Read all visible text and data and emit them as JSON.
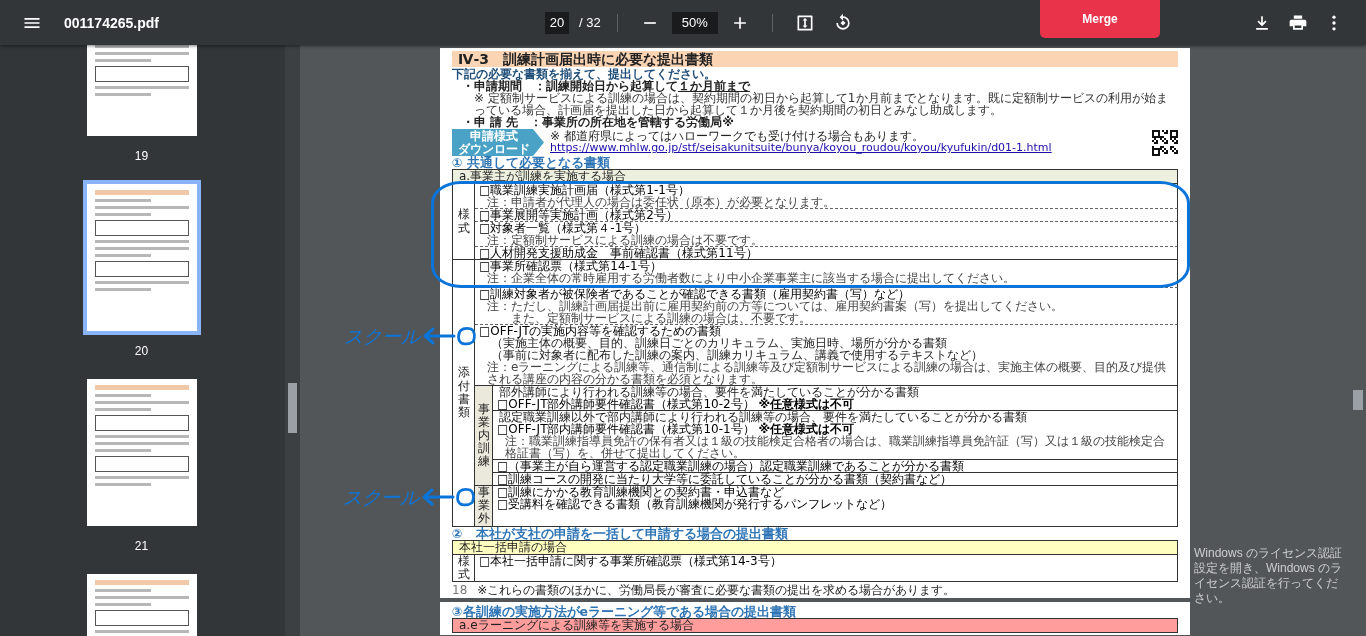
{
  "toolbar": {
    "file_name": "001174265.pdf",
    "page_current": "20",
    "page_total": "/ 32",
    "zoom": "50%",
    "merge": "Merge"
  },
  "thumbnails": [
    {
      "label": "19",
      "selected": false
    },
    {
      "label": "20",
      "selected": true
    },
    {
      "label": "21",
      "selected": false
    },
    {
      "selected": false
    }
  ],
  "document": {
    "pages": [
      {
        "title": "Ⅳ-3　訓練計画届出時に必要な提出書類",
        "intro": "下記の必要な書類を揃えて、提出してください。",
        "period": {
          "label": "・申請期間　：",
          "value": "訓練開始日から起算して",
          "emphasis": "１か月前まで"
        },
        "period_note": "※ 定額制サービスによる訓練の場合は、契約期間の初日から起算して1か月前までとなります。既に定額制サービスの利用が始まっている場合、計画届を提出した日から起算して１か月後を契約期間の初日とみなし助成します。",
        "applicant": {
          "label": "・申 請 先　：",
          "value": "事業所の所在地を管轄する労働局",
          "mark": "※"
        },
        "applicant_note": "※ 都道府県によってはハローワークでも受け付ける場合もあります。",
        "download": {
          "badge": [
            "申請様式",
            "ダウンロード"
          ],
          "url": "https://www.mhlw.go.jp/stf/seisakunitsuite/bunya/koyou_roudou/koyou/kyufukin/d01-1.html"
        },
        "sections": [
          {
            "heading": "① 共通して必要となる書類",
            "table": {
              "header": "a.事業主が訓練を実施する場合",
              "color": "#eef0df",
              "groups": [
                {
                  "label": "様式",
                  "items": [
                    {
                      "lines": [
                        {
                          "kind": "main",
                          "text": "□職業訓練実施計画届（様式第1-1号）"
                        },
                        {
                          "kind": "note",
                          "text": "注：申請者が代理人の場合は委任状（原本）が必要となります。"
                        }
                      ]
                    },
                    {
                      "lines": [
                        {
                          "kind": "main",
                          "text": "□事業展開等実施計画（様式第2号）"
                        }
                      ]
                    },
                    {
                      "lines": [
                        {
                          "kind": "main",
                          "text": "□対象者一覧（様式第４-1号）"
                        },
                        {
                          "kind": "note",
                          "text": "注：定額制サービスによる訓練の場合は不要です。"
                        }
                      ]
                    },
                    {
                      "lines": [
                        {
                          "kind": "main",
                          "text": "□人材開発支援助成金　事前確認書（様式第11号）"
                        }
                      ]
                    }
                  ]
                },
                {
                  "label": "添付書類",
                  "items": [
                    {
                      "lines": [
                        {
                          "kind": "main",
                          "text": "□事業所確認票（様式第14-1号）"
                        },
                        {
                          "kind": "note",
                          "text": "注：企業全体の常時雇用する労働者数により中小企業事業主に該当する場合に提出してください。"
                        }
                      ]
                    },
                    {
                      "lines": [
                        {
                          "kind": "main",
                          "text": "□訓練対象者が被保険者であることが確認できる書類",
                          "tail": "（雇用契約書（写）など）"
                        },
                        {
                          "kind": "note",
                          "text": "注：ただし、訓練計画届提出前に雇用契約前の方等については、雇用契約書案（写）を提出してください。"
                        },
                        {
                          "kind": "note",
                          "text": "　　また、定額制サービスによる訓練の場合は、不要です。"
                        }
                      ]
                    },
                    {
                      "annotation": "スクール",
                      "lines": [
                        {
                          "kind": "main",
                          "text": "□OFF-JTの実施内容等を確認するための書類"
                        },
                        {
                          "kind": "detail",
                          "text": "（実施主体の概要、目的、訓練日ごとのカリキュラム、実施日時、場所が分かる書類"
                        },
                        {
                          "kind": "detail",
                          "text": "（事前に対象者に配布した訓練の案内、訓練カリキュラム、講義で使用するテキストなど）"
                        },
                        {
                          "kind": "note",
                          "text": "注：eラーニングによる訓練等、通信制による訓練等及び定額制サービスによる訓練の場合は、実施主体の概要、目的及び提供される講座の内容の分かる書類を必須となります。"
                        }
                      ]
                    }
                  ],
                  "subgroups": [
                    {
                      "label": "事業内訓練",
                      "items": [
                        {
                          "lines": [
                            {
                              "kind": "lead",
                              "text": "部外講師により行われる訓練等の場合、要件を満たしていることが分かる書類"
                            },
                            {
                              "kind": "main",
                              "text": "□OFF-JT部外講師要件確認書（様式第10-2号）",
                              "strong": "※任意様式は不可"
                            }
                          ]
                        },
                        {
                          "lines": [
                            {
                              "kind": "lead",
                              "text": "認定職業訓練以外で部内講師により行われる訓練等の場合、要件を満たしていることが分かる書類"
                            },
                            {
                              "kind": "main",
                              "text": "□OFF-JT部内講師要件確認書（様式第10-1号）",
                              "strong": "※任意様式は不可"
                            },
                            {
                              "kind": "note",
                              "text": "注：職業訓練指導員免許の保有者又は１級の技能検定合格者の場合は、職業訓練指導員免許証（写）又は１級の技能検定合格証書（写）を、併せて提出してください。"
                            }
                          ]
                        },
                        {
                          "lines": [
                            {
                              "kind": "main",
                              "lead": "□（事業主が自ら運営する認定職業訓練の場合）",
                              "text": "認定職業訓練であることが分かる書類"
                            }
                          ]
                        },
                        {
                          "lines": [
                            {
                              "kind": "main",
                              "text": "□訓練コースの開発に当たり大学等に委託していることが分かる書類",
                              "tail": "（契約書など）"
                            }
                          ]
                        }
                      ]
                    },
                    {
                      "label": "事業外",
                      "items": [
                        {
                          "annotation": "スクール",
                          "lines": [
                            {
                              "kind": "main",
                              "text": "□訓練にかかる教育訓練機関との契約書・申込書など"
                            },
                            {
                              "kind": "main",
                              "text": "□受講料を確認できる書類（教育訓練機関が発行するパンフレットなど）"
                            }
                          ]
                        }
                      ]
                    }
                  ]
                }
              ]
            }
          },
          {
            "heading": "②　本社が支社の申請を一括して申請する場合の提出書類",
            "table": {
              "header": "本社一括申請の場合",
              "color": "#ffffc0",
              "groups": [
                {
                  "label": "様式",
                  "items": [
                    {
                      "lines": [
                        {
                          "kind": "main",
                          "text": "□本社一括申請に関する事業所確認票（様式第14-3号）"
                        }
                      ]
                    }
                  ]
                }
              ]
            }
          }
        ],
        "footer": {
          "page_number": "18",
          "note": "※これらの書類のほかに、労働局長が審査に必要な書類の提出を求める場合があります。"
        }
      },
      {
        "sections": [
          {
            "heading": "③各訓練の実施方法がeラーニング等である場合の提出書類",
            "table": {
              "header": "a.eラーニングによる訓練等を実施する場合",
              "color": "#ff9c9c"
            }
          }
        ]
      }
    ]
  },
  "os_notice": {
    "title": "Windows のライセンス認証",
    "message": "設定を開き、Windows のライセンス認証を行ってください。"
  }
}
